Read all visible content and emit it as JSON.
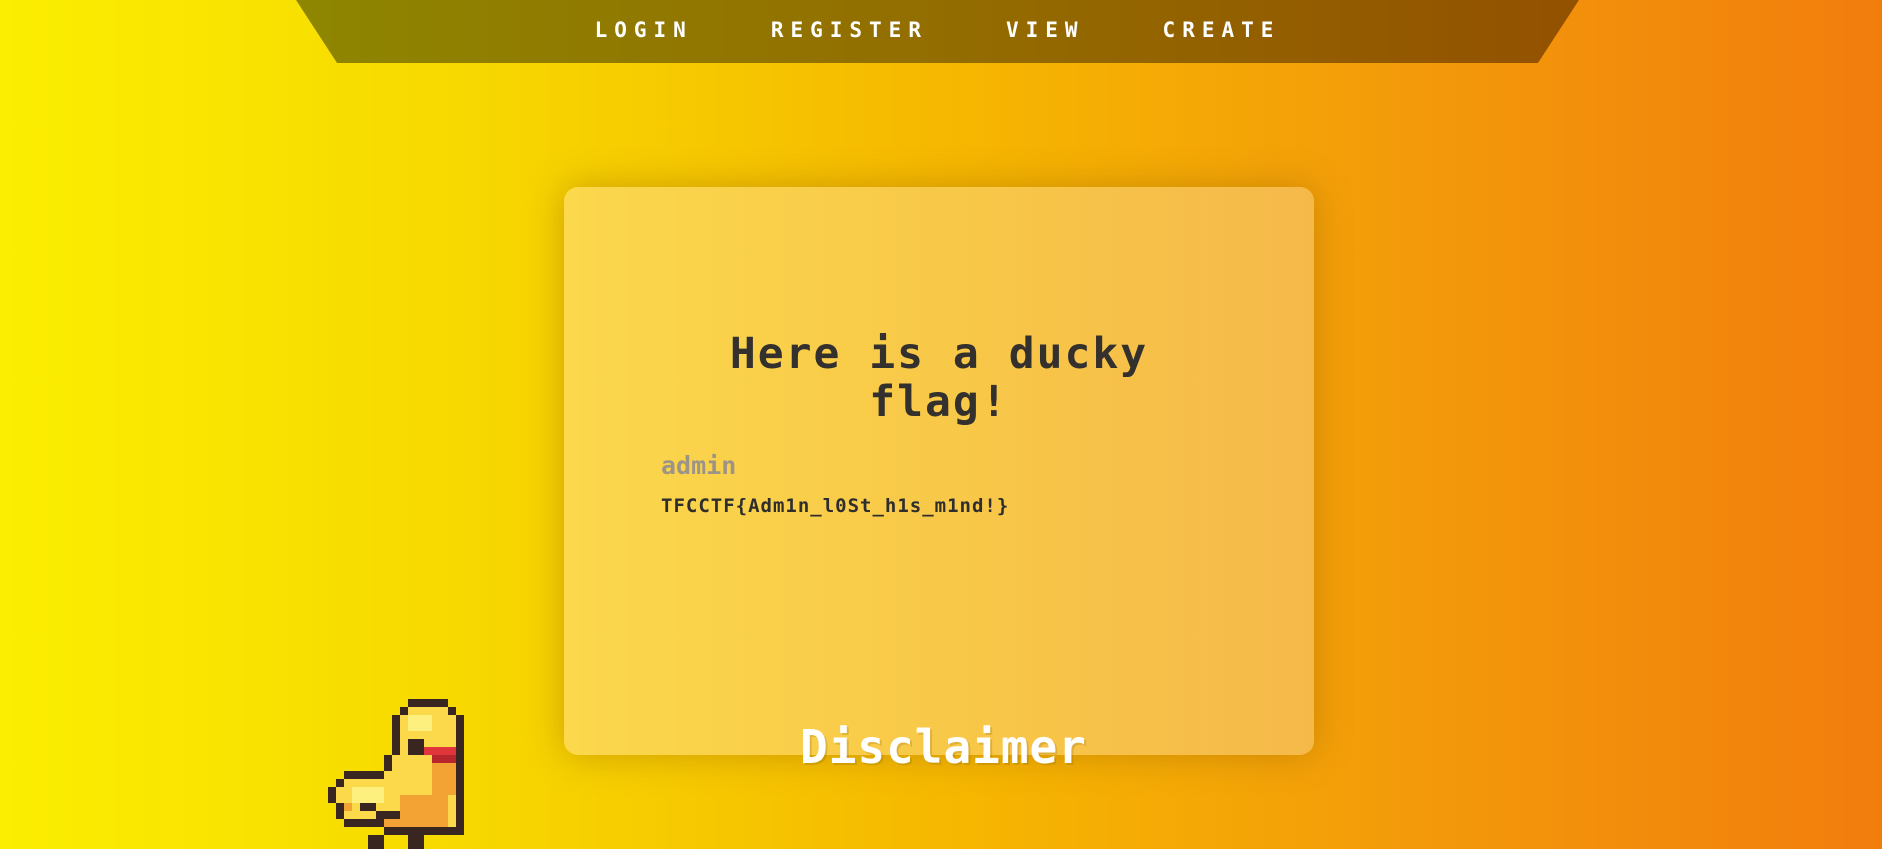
{
  "nav": {
    "links": [
      "LOGIN",
      "REGISTER",
      "VIEW",
      "CREATE"
    ]
  },
  "card": {
    "title": "Here is a ducky flag!",
    "username": "admin",
    "flag": "TFCCTF{Adm1n_l0St_h1s_m1nd!}"
  },
  "footer": {
    "disclaimer": "Disclaimer"
  },
  "mascot": {
    "icon": "pixel-duck-icon"
  },
  "colors": {
    "background_start": "#fbee00",
    "background_end": "#f27d0d",
    "navbar": "#936d00",
    "card": "#f8c748",
    "title_text": "#33302d",
    "username_text": "#9d9488"
  }
}
